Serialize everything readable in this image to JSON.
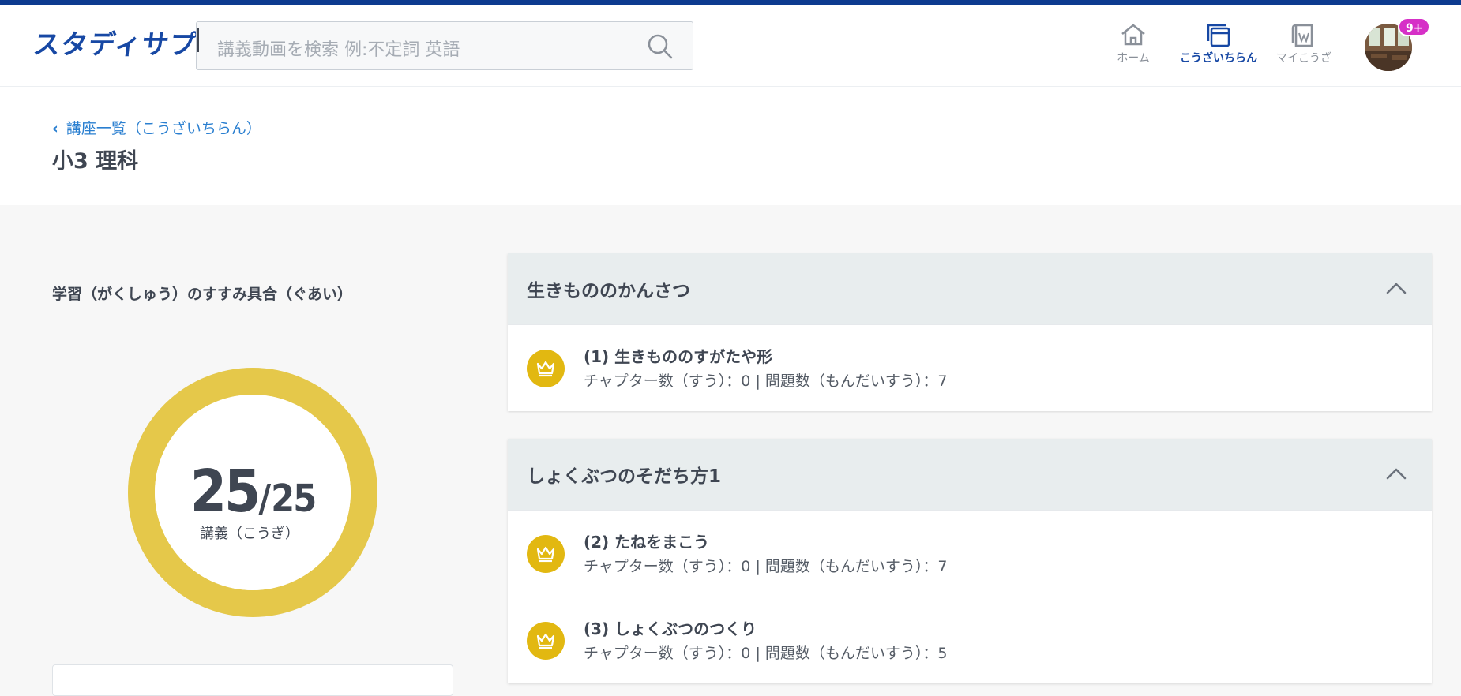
{
  "header": {
    "logo": "スタディサプリ",
    "search_placeholder": "講義動画を検索 例:不定詞 英語",
    "nav": [
      {
        "label": "ホーム",
        "icon": "home-icon",
        "active": false
      },
      {
        "label": "こうざいちらん",
        "icon": "course-list-icon",
        "active": true
      },
      {
        "label": "マイこうざ",
        "icon": "my-course-icon",
        "active": false
      }
    ],
    "notification_badge": "9+"
  },
  "course": {
    "breadcrumb": "講座一覧（こうざいちらん）",
    "title": "小3 理科"
  },
  "progress": {
    "heading": "学習（がくしゅう）のすすみ具合（ぐあい）",
    "completed": "25",
    "total": "25",
    "separator": "/",
    "unit_label": "講義（こうぎ）",
    "ratio": 1.0,
    "ring_color": "#e5c84a"
  },
  "chapters": [
    {
      "title": "生きもののかんさつ",
      "lessons": [
        {
          "title": "(1) 生きもののすがたや形",
          "meta": "チャプター数（すう）：0 | 問題数（もんだいすう）：7"
        }
      ]
    },
    {
      "title": "しょくぶつのそだち方1",
      "lessons": [
        {
          "title": "(2) たねをまこう",
          "meta": "チャプター数（すう）：0 | 問題数（もんだいすう）：7"
        },
        {
          "title": "(3) しょくぶつのつくり",
          "meta": "チャプター数（すう）：0 | 問題数（もんだいすう）：5"
        }
      ]
    }
  ],
  "colors": {
    "brand": "#1748a4",
    "link": "#2a7fd0",
    "badge": "#d630c7",
    "crown": "#e2b811"
  }
}
